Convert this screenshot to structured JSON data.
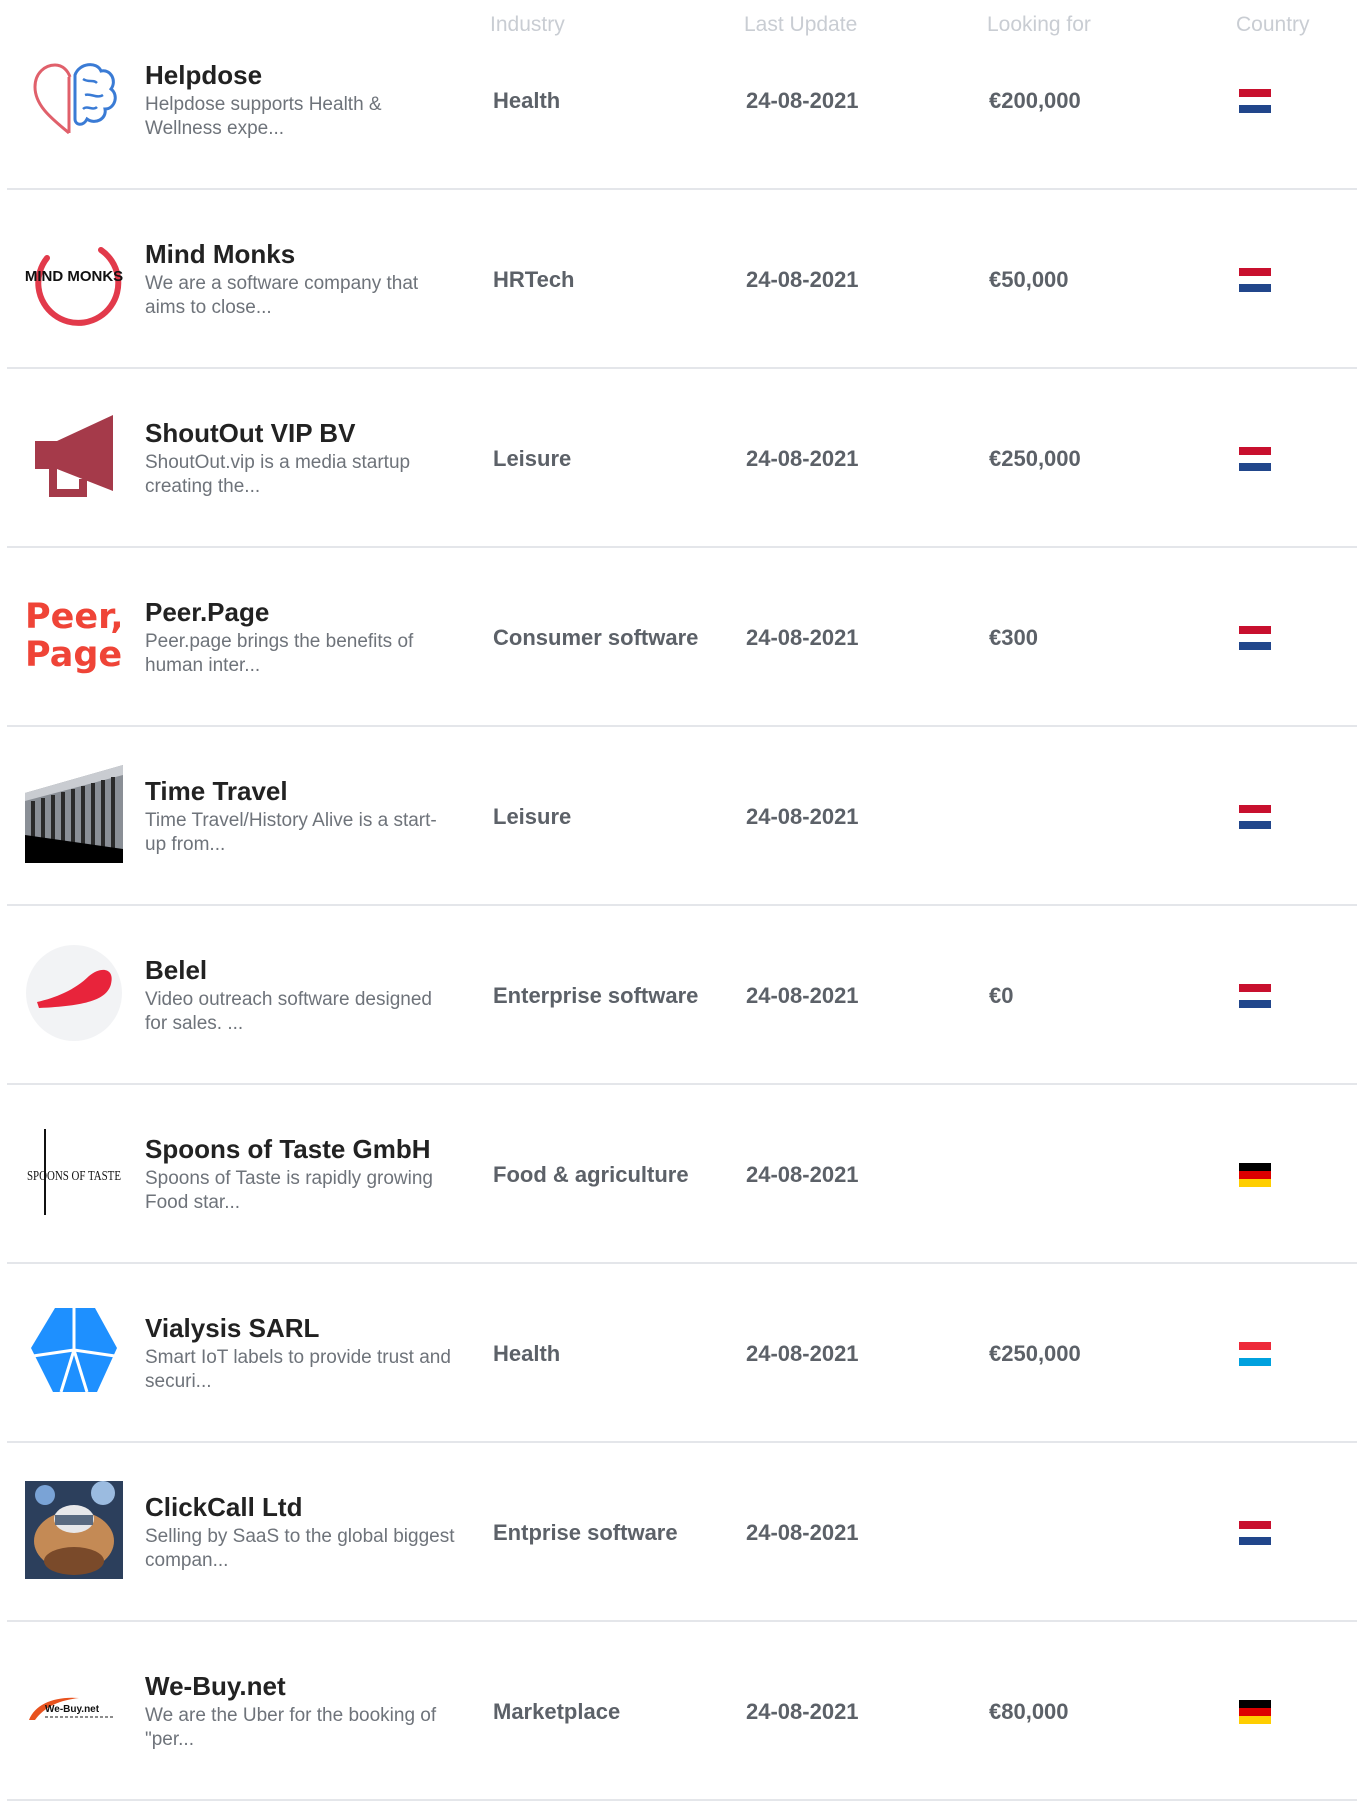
{
  "header": {
    "industry": "Industry",
    "last_update": "Last Update",
    "looking_for": "Looking for",
    "country": "Country"
  },
  "rows": [
    {
      "name": "Helpdose",
      "desc": "Helpdose supports Health & Wellness expe...",
      "industry": "Health",
      "updated": "24-08-2021",
      "looking": "€200,000",
      "logo": "heart-brain-logo",
      "flag": [
        "#c8102e",
        "#ffffff",
        "#21468b"
      ]
    },
    {
      "name": "Mind Monks",
      "desc": "We are a software company that aims to close...",
      "industry": "HRTech",
      "updated": "24-08-2021",
      "looking": "€50,000",
      "logo": "mind-monks-logo",
      "logo_text": "MIND MONKS",
      "flag": [
        "#c8102e",
        "#ffffff",
        "#21468b"
      ]
    },
    {
      "name": "ShoutOut VIP BV",
      "desc": "ShoutOut.vip is a media startup creating the...",
      "industry": "Leisure",
      "updated": "24-08-2021",
      "looking": "€250,000",
      "logo": "megaphone-logo",
      "flag": [
        "#c8102e",
        "#ffffff",
        "#21468b"
      ]
    },
    {
      "name": "Peer.Page",
      "desc": "Peer.page brings the benefits of human inter...",
      "industry": "Consumer software",
      "updated": "24-08-2021",
      "looking": "€300",
      "logo": "peer-page-logo",
      "logo_text": [
        "Peer,",
        "Page"
      ],
      "flag": [
        "#c8102e",
        "#ffffff",
        "#21468b"
      ]
    },
    {
      "name": "Time Travel",
      "desc": "Time Travel/History Alive is a start-up from...",
      "industry": "Leisure",
      "updated": "24-08-2021",
      "looking": "",
      "logo": "colonnade-photo-logo",
      "flag": [
        "#c8102e",
        "#ffffff",
        "#21468b"
      ]
    },
    {
      "name": "Belel",
      "desc": "Video outreach software designed for sales. ...",
      "industry": "Enterprise software",
      "updated": "24-08-2021",
      "looking": "€0",
      "logo": "red-swoosh-logo",
      "flag": [
        "#c8102e",
        "#ffffff",
        "#21468b"
      ]
    },
    {
      "name": "Spoons of Taste GmbH",
      "desc": "Spoons of Taste is rapidly growing Food star...",
      "industry": "Food & agriculture",
      "updated": "24-08-2021",
      "looking": "",
      "logo": "spoons-of-taste-logo",
      "logo_text": "SPOONS OF TASTE",
      "flag": [
        "#000000",
        "#dd0000",
        "#ffce00"
      ]
    },
    {
      "name": "Vialysis SARL",
      "desc": "Smart IoT labels to provide trust and securi...",
      "industry": "Health",
      "updated": "24-08-2021",
      "looking": "€250,000",
      "logo": "blue-hexagon-logo",
      "flag": [
        "#ed2939",
        "#ffffff",
        "#00a1de"
      ]
    },
    {
      "name": "ClickCall Ltd",
      "desc": "Selling by SaaS to the global biggest compan...",
      "industry": "Entprise software",
      "updated": "24-08-2021",
      "looking": "",
      "logo": "clickcall-photo-logo",
      "flag": [
        "#c8102e",
        "#ffffff",
        "#21468b"
      ]
    },
    {
      "name": "We-Buy.net",
      "desc": "We are the Uber for the booking of \"per...",
      "industry": "Marketplace",
      "updated": "24-08-2021",
      "looking": "€80,000",
      "logo": "we-buy-logo",
      "logo_text": "We-Buy.net",
      "flag": [
        "#000000",
        "#dd0000",
        "#ffce00"
      ]
    }
  ]
}
